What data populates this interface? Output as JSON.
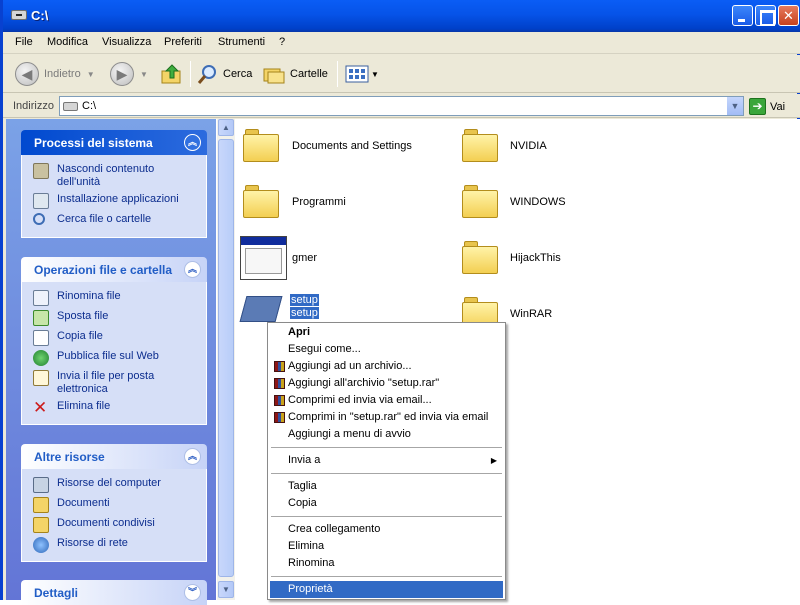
{
  "window": {
    "title": "C:\\"
  },
  "menubar": [
    "File",
    "Modifica",
    "Visualizza",
    "Preferiti",
    "Strumenti",
    "?"
  ],
  "toolbar": {
    "back": "Indietro",
    "search": "Cerca",
    "folders": "Cartelle"
  },
  "address": {
    "label": "Indirizzo",
    "value": "C:\\",
    "go": "Vai"
  },
  "sidebar": {
    "system": {
      "title": "Processi del sistema",
      "items": [
        "Nascondi contenuto dell'unità",
        "Installazione applicazioni",
        "Cerca file o cartelle"
      ]
    },
    "fileops": {
      "title": "Operazioni file e cartella",
      "items": [
        "Rinomina file",
        "Sposta file",
        "Copia file",
        "Pubblica file sul Web",
        "Invia il file per posta elettronica",
        "Elimina file"
      ]
    },
    "other": {
      "title": "Altre risorse",
      "items": [
        "Risorse del computer",
        "Documenti",
        "Documenti condivisi",
        "Risorse di rete"
      ]
    },
    "details": {
      "title": "Dettagli"
    }
  },
  "files": [
    {
      "name": "Documents and Settings",
      "type": "folder"
    },
    {
      "name": "NVIDIA",
      "type": "folder"
    },
    {
      "name": "Programmi",
      "type": "folder"
    },
    {
      "name": "WINDOWS",
      "type": "folder"
    },
    {
      "name": "gmer",
      "type": "app"
    },
    {
      "name": "HijackThis",
      "type": "folder"
    },
    {
      "name": "setup",
      "subtitle": "setup",
      "type": "installer"
    },
    {
      "name": "WinRAR",
      "type": "folder"
    }
  ],
  "context_menu": {
    "items": [
      "Apri",
      "Esegui come...",
      "Aggiungi ad un archivio...",
      "Aggiungi all'archivio \"setup.rar\"",
      "Comprimi ed invia via email...",
      "Comprimi in \"setup.rar\" ed invia via email",
      "Aggiungi a menu di avvio",
      "Invia a",
      "Taglia",
      "Copia",
      "Crea collegamento",
      "Elimina",
      "Rinomina",
      "Proprietà"
    ],
    "highlighted": "Proprietà"
  },
  "colors": {
    "titlebar": "#0653e8",
    "sidebar": "#6f8ddf",
    "selection": "#316ac5",
    "link": "#0c2d8e"
  }
}
